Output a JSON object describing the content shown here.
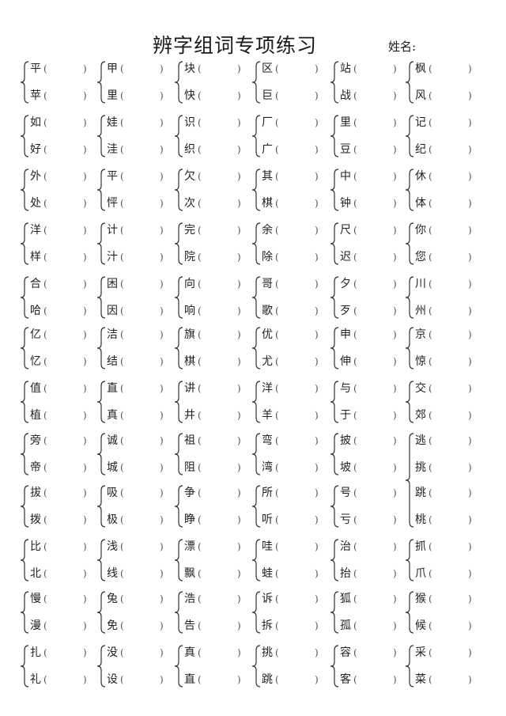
{
  "header": {
    "title": "辨字组词专项练习",
    "name_label": "姓名:"
  },
  "paren_open": "(",
  "paren_close": ")",
  "rows": [
    {
      "groups": [
        [
          "平",
          "苹"
        ],
        [
          "甲",
          "里"
        ],
        [
          "块",
          "快"
        ],
        [
          "区",
          "巨"
        ],
        [
          "站",
          "战"
        ],
        [
          "枫",
          "风"
        ]
      ]
    },
    {
      "groups": [
        [
          "如",
          "好"
        ],
        [
          "娃",
          "洼"
        ],
        [
          "识",
          "织"
        ],
        [
          "厂",
          "广"
        ],
        [
          "里",
          "豆"
        ],
        [
          "记",
          "纪"
        ]
      ]
    },
    {
      "groups": [
        [
          "外",
          "处"
        ],
        [
          "平",
          "怦"
        ],
        [
          "欠",
          "次"
        ],
        [
          "其",
          "棋"
        ],
        [
          "中",
          "钟"
        ],
        [
          "休",
          "体"
        ]
      ]
    },
    {
      "groups": [
        [
          "洋",
          "样"
        ],
        [
          "计",
          "汁"
        ],
        [
          "完",
          "院"
        ],
        [
          "余",
          "除"
        ],
        [
          "尺",
          "迟"
        ],
        [
          "你",
          "您"
        ]
      ]
    },
    {
      "groups": [
        [
          "合",
          "哈"
        ],
        [
          "困",
          "因"
        ],
        [
          "向",
          "响"
        ],
        [
          "哥",
          "歌"
        ],
        [
          "夕",
          "歹"
        ],
        [
          "川",
          "州"
        ]
      ]
    },
    {
      "groups": [
        [
          "亿",
          "忆"
        ],
        [
          "洁",
          "结"
        ],
        [
          "旗",
          "棋"
        ],
        [
          "优",
          "尤"
        ],
        [
          "申",
          "伸"
        ],
        [
          "京",
          "惊"
        ]
      ]
    },
    {
      "groups": [
        [
          "值",
          "植"
        ],
        [
          "直",
          "真"
        ],
        [
          "讲",
          "井"
        ],
        [
          "洋",
          "羊"
        ],
        [
          "与",
          "于"
        ],
        [
          "交",
          "郊"
        ]
      ]
    },
    {
      "groups": [
        [
          "旁",
          "帝"
        ],
        [
          "诚",
          "城"
        ],
        [
          "祖",
          "阻"
        ],
        [
          "弯",
          "湾"
        ],
        [
          "披",
          "坡"
        ]
      ]
    },
    {
      "groups": [
        [
          "拔",
          "拨"
        ],
        [
          "吸",
          "极"
        ],
        [
          "争",
          "睁"
        ],
        [
          "所",
          "听"
        ],
        [
          "号",
          "亏"
        ]
      ]
    },
    {
      "groups": [
        [
          "比",
          "北"
        ],
        [
          "浅",
          "线"
        ],
        [
          "漂",
          "飘"
        ],
        [
          "哇",
          "蛙"
        ],
        [
          "治",
          "抬"
        ],
        [
          "抓",
          "爪"
        ]
      ]
    },
    {
      "groups": [
        [
          "慢",
          "漫"
        ],
        [
          "兔",
          "免"
        ],
        [
          "浩",
          "告"
        ],
        [
          "诉",
          "拆"
        ],
        [
          "狐",
          "孤"
        ],
        [
          "猴",
          "候"
        ]
      ]
    },
    {
      "groups": [
        [
          "扎",
          "礼"
        ],
        [
          "没",
          "设"
        ],
        [
          "真",
          "直"
        ],
        [
          "挑",
          "跳"
        ],
        [
          "容",
          "客"
        ],
        [
          "采",
          "菜"
        ]
      ]
    }
  ],
  "big_group": [
    "逃",
    "挑",
    "跳",
    "桃"
  ]
}
